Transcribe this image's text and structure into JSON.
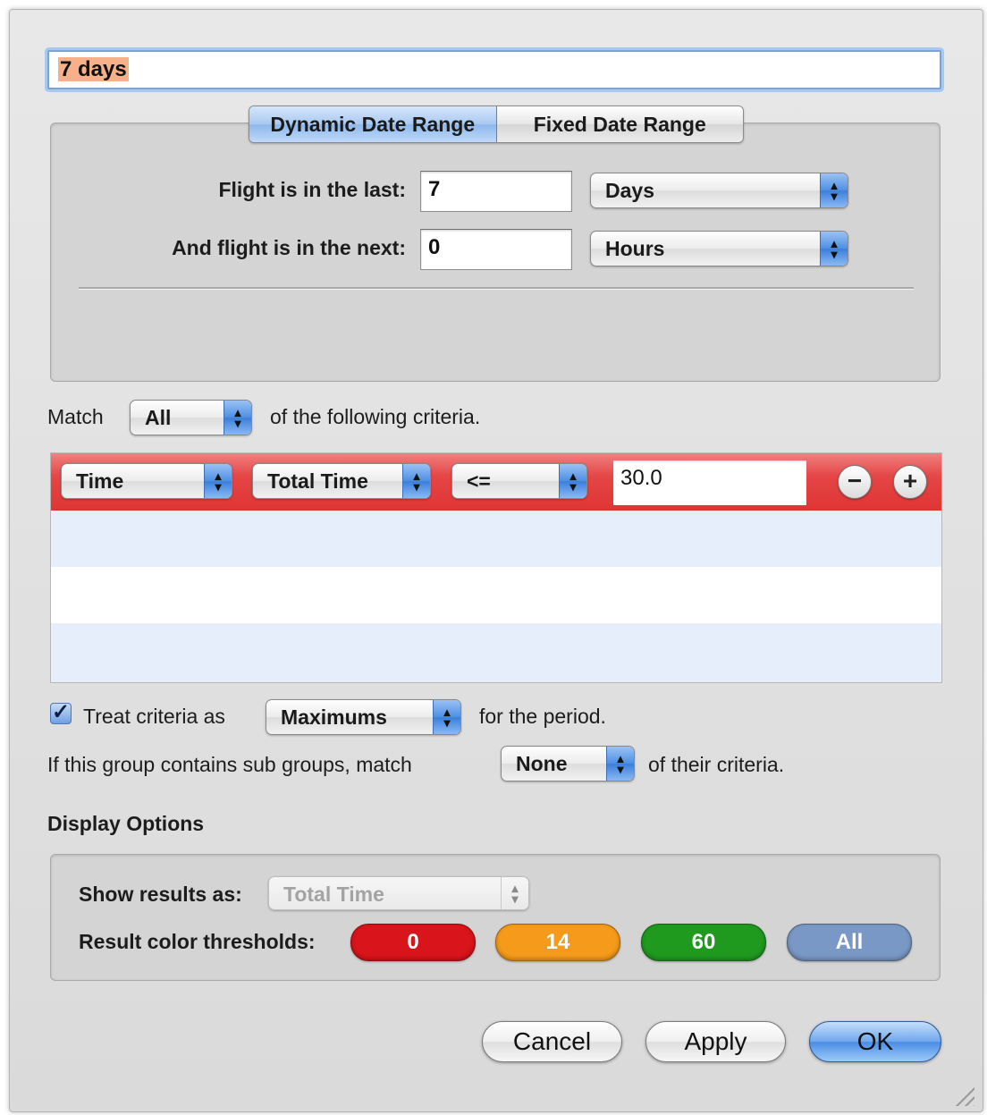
{
  "name_field": {
    "value": "7 days"
  },
  "date_range": {
    "tabs": [
      {
        "label": "Dynamic Date Range",
        "active": true
      },
      {
        "label": "Fixed Date Range",
        "active": false
      }
    ],
    "last_label": "Flight is in the last:",
    "last_value": "7",
    "last_unit": "Days",
    "next_label": "And flight is in the next:",
    "next_value": "0",
    "next_unit": "Hours"
  },
  "match": {
    "prefix": "Match",
    "value": "All",
    "suffix": "of the following criteria."
  },
  "criteria": {
    "row": {
      "field": "Time",
      "subfield": "Total Time",
      "operator": "<=",
      "value": "30.0",
      "remove_symbol": "−",
      "add_symbol": "+"
    },
    "highlight_color": "#e23b3b"
  },
  "treat": {
    "checked": true,
    "check_glyph": "✓",
    "prefix": "Treat criteria as",
    "value": "Maximums",
    "suffix": "for the period."
  },
  "subgroups": {
    "prefix": "If this group contains sub groups, match",
    "value": "None",
    "suffix": "of their criteria."
  },
  "display_options": {
    "heading": "Display Options",
    "show_results_label": "Show results as:",
    "show_results_value": "Total Time",
    "thresholds_label": "Result color thresholds:",
    "thresholds": [
      {
        "label": "0",
        "color": "#d9141a"
      },
      {
        "label": "14",
        "color": "#f59a1a"
      },
      {
        "label": "60",
        "color": "#1f9a1f"
      },
      {
        "label": "All",
        "color": "#7a98c6"
      }
    ]
  },
  "buttons": {
    "cancel": "Cancel",
    "apply": "Apply",
    "ok": "OK"
  },
  "icons": {
    "popup_arrows_up": "▴",
    "popup_arrows_down": "▾"
  }
}
